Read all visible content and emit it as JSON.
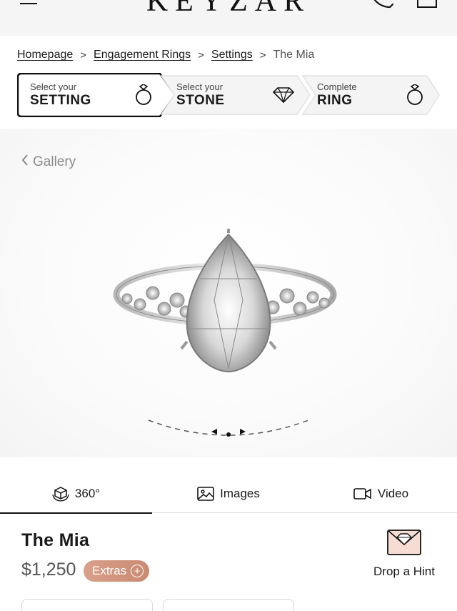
{
  "header": {
    "logo": "KEYZAR"
  },
  "breadcrumb": {
    "items": [
      "Homepage",
      "Engagement Rings",
      "Settings"
    ],
    "current": "The Mia",
    "separator": ">"
  },
  "steps": [
    {
      "small": "Select your",
      "big": "SETTING",
      "icon": "ring-icon",
      "active": true
    },
    {
      "small": "Select your",
      "big": "STONE",
      "icon": "diamond-icon",
      "active": false
    },
    {
      "small": "Complete",
      "big": "RING",
      "icon": "ring-icon",
      "active": false
    }
  ],
  "gallery": {
    "back_label": "Gallery"
  },
  "tabs": [
    {
      "label": "360°",
      "icon": "cube-360-icon",
      "active": true
    },
    {
      "label": "Images",
      "icon": "image-icon",
      "active": false
    },
    {
      "label": "Video",
      "icon": "video-icon",
      "active": false
    }
  ],
  "product": {
    "name": "The Mia",
    "price": "$1,250",
    "extras_label": "Extras",
    "hint_label": "Drop a Hint"
  },
  "colors": {
    "accent": "#cf9279",
    "text": "#1a1a1a",
    "muted": "#8a8a8a",
    "header_bg": "#f5f5f5"
  }
}
